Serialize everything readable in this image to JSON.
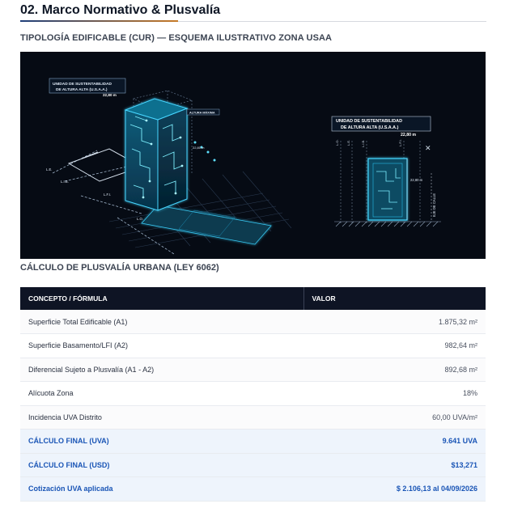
{
  "page": {
    "title": "02. Marco Normativo & Plusvalía",
    "section_typology": "TIPOLOGÍA EDIFICABLE (CUR) — ESQUEMA ILUSTRATIVO ZONA USAA",
    "section_calc": "CÁLCULO DE PLUSVALÍA URBANA (LEY 6062)"
  },
  "figure": {
    "left_label_line1": "UNIDAD DE SUSTENTABILIDAD",
    "left_label_line2": "DE ALTURA ALTA (U.S.A.A.)",
    "left_height": "22,80 m",
    "altura_maxima": "ALTURA MÁXIMA",
    "side_height": "22,80 m",
    "lbl_le": "L.E.",
    "lbl_lib": "L.I.B.",
    "lbl_lfi": "L.F.I.",
    "lbl_lo": "L.O.",
    "right_label_line1": "UNIDAD DE SUSTENTABILIDAD",
    "right_label_line2": "DE ALTURA ALTA (U.S.A.A.)",
    "right_height": "22,80 m",
    "right_side_height": "22,80 m",
    "eje_calle": "EJE DE CALLE",
    "col_labels": [
      "L.O.",
      "L.E.",
      "L.I.B.",
      "L.F.I.",
      "L.I."
    ]
  },
  "table": {
    "headers": {
      "concept": "CONCEPTO / FÓRMULA",
      "value": "VALOR"
    },
    "rows": [
      {
        "concept": "Superficie Total Edificable (A1)",
        "value": "1.875,32 m²",
        "highlight": false
      },
      {
        "concept": "Superficie Basamento/LFI (A2)",
        "value": "982,64 m²",
        "highlight": false
      },
      {
        "concept": "Diferencial Sujeto a Plusvalía (A1 - A2)",
        "value": "892,68 m²",
        "highlight": false
      },
      {
        "concept": "Alícuota Zona",
        "value": "18%",
        "highlight": false
      },
      {
        "concept": "Incidencia UVA Distrito",
        "value": "60,00 UVA/m²",
        "highlight": false
      },
      {
        "concept": "CÁLCULO FINAL (UVA)",
        "value": "9.641 UVA",
        "highlight": true
      },
      {
        "concept": "CÁLCULO FINAL (USD)",
        "value": "$13,271",
        "highlight": true
      },
      {
        "concept": "Cotización UVA aplicada",
        "value": "$ 2.106,13 al 04/09/2026",
        "highlight": true
      }
    ]
  },
  "colors": {
    "accent_blue": "#1a55b6",
    "header_dark": "#0e1424",
    "neon": "#39d0ff"
  }
}
